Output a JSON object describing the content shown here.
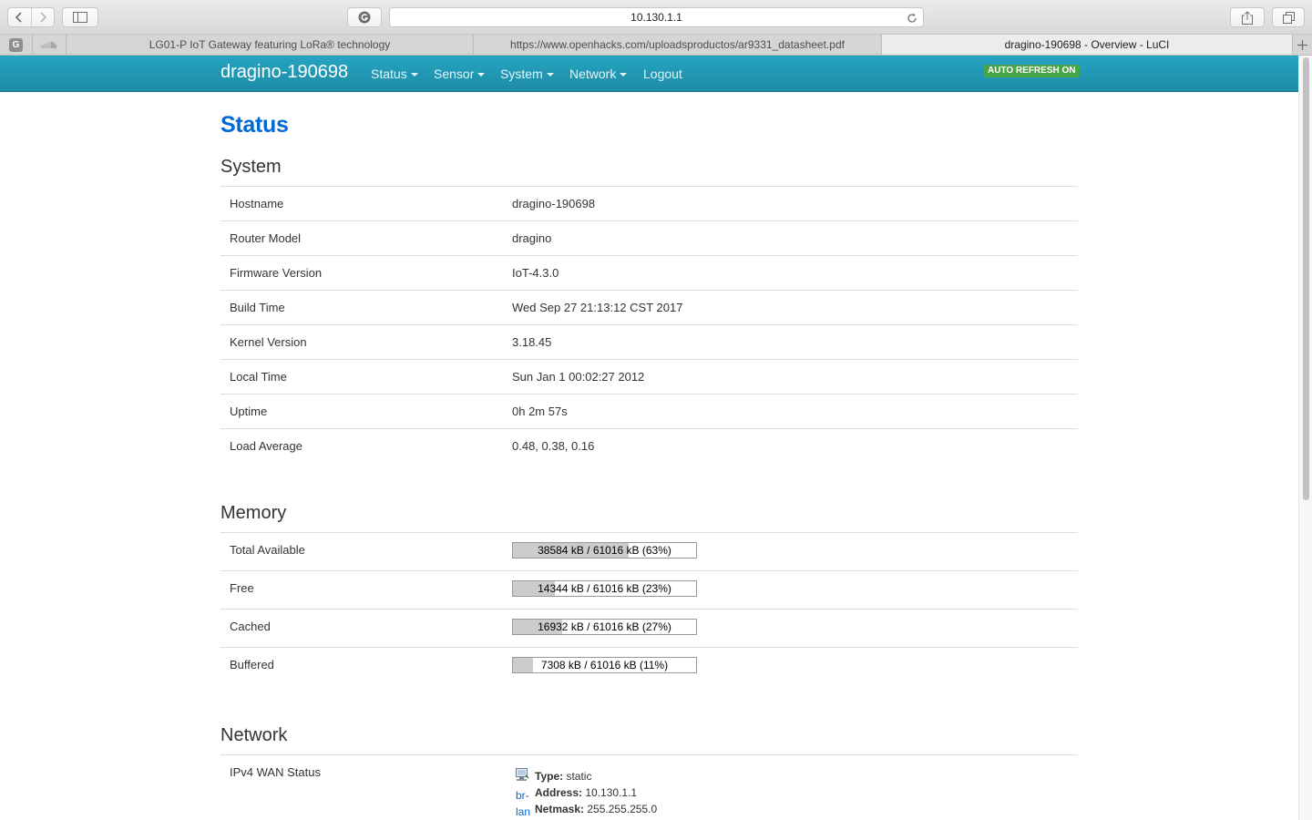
{
  "browser": {
    "address": "10.130.1.1",
    "pinned_tab_letter": "G",
    "tabs": [
      {
        "title": "LG01-P IoT Gateway featuring LoRa® technology"
      },
      {
        "title": "https://www.openhacks.com/uploadsproductos/ar9331_datasheet.pdf"
      },
      {
        "title": "dragino-190698 - Overview - LuCI"
      }
    ]
  },
  "header": {
    "brand": "dragino-190698",
    "menu": [
      "Status",
      "Sensor",
      "System",
      "Network",
      "Logout"
    ],
    "auto_refresh": "AUTO REFRESH ON",
    "colors": {
      "bar": "#1d8ca6",
      "refresh_badge": "#46a546"
    }
  },
  "page": {
    "title": "Status",
    "system": {
      "heading": "System",
      "rows": [
        {
          "label": "Hostname",
          "value": "dragino-190698"
        },
        {
          "label": "Router Model",
          "value": "dragino"
        },
        {
          "label": "Firmware Version",
          "value": "IoT-4.3.0"
        },
        {
          "label": "Build Time",
          "value": "Wed Sep 27 21:13:12 CST 2017"
        },
        {
          "label": "Kernel Version",
          "value": "3.18.45"
        },
        {
          "label": "Local Time",
          "value": "Sun Jan 1 00:02:27 2012"
        },
        {
          "label": "Uptime",
          "value": "0h 2m 57s"
        },
        {
          "label": "Load Average",
          "value": "0.48, 0.38, 0.16"
        }
      ]
    },
    "memory": {
      "heading": "Memory",
      "rows": [
        {
          "label": "Total Available",
          "text": "38584 kB / 61016 kB (63%)",
          "percent": 63
        },
        {
          "label": "Free",
          "text": "14344 kB / 61016 kB (23%)",
          "percent": 23
        },
        {
          "label": "Cached",
          "text": "16932 kB / 61016 kB (27%)",
          "percent": 27
        },
        {
          "label": "Buffered",
          "text": "7308 kB / 61016 kB (11%)",
          "percent": 11
        }
      ]
    },
    "network": {
      "heading": "Network",
      "wan_label": "IPv4 WAN Status",
      "wan_device_top": "br-",
      "wan_device_bottom": "lan",
      "type_key": "Type:",
      "type_value": "static",
      "address_key": "Address:",
      "address_value": "10.130.1.1",
      "netmask_key": "Netmask:",
      "netmask_value": "255.255.255.0"
    }
  }
}
